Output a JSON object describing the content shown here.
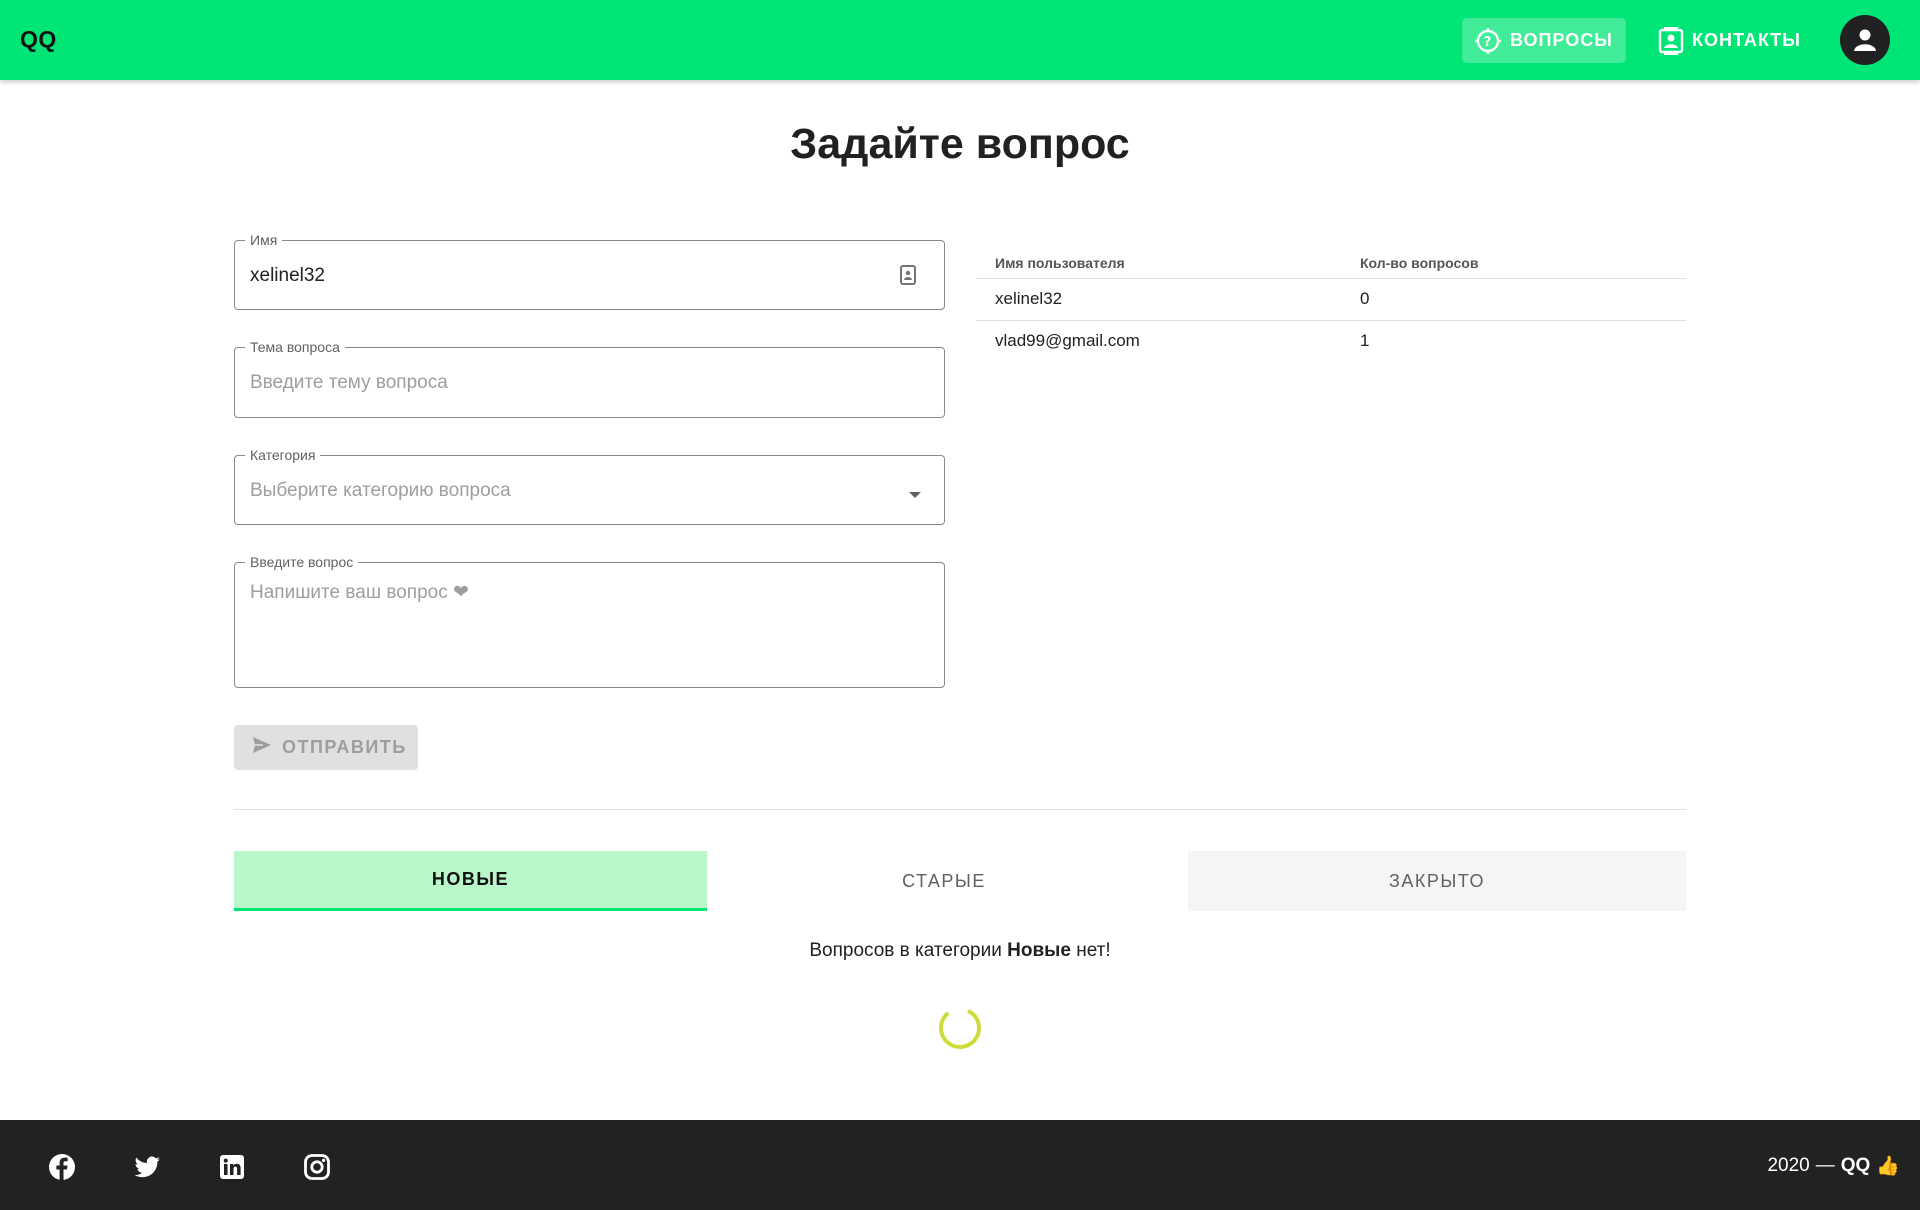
{
  "header": {
    "brand": "QQ",
    "nav": [
      {
        "label": "ВОПРОСЫ",
        "icon": "question-target-icon",
        "active": true
      },
      {
        "label": "КОНТАКТЫ",
        "icon": "contacts-card-icon",
        "active": false
      }
    ],
    "avatar_icon": "account-icon"
  },
  "page": {
    "title": "Задайте вопрос"
  },
  "form": {
    "name": {
      "label": "Имя",
      "value": "xelinel32",
      "icon": "id-card-icon"
    },
    "topic": {
      "label": "Тема вопроса",
      "placeholder": "Введите тему вопроса"
    },
    "category": {
      "label": "Категория",
      "placeholder": "Выберите категорию вопроса",
      "icon": "dropdown-arrow-icon"
    },
    "question": {
      "label": "Введите вопрос",
      "placeholder": "Напишите ваш вопрос ❤"
    },
    "submit": {
      "label": "ОТПРАВИТЬ",
      "icon": "send-icon",
      "disabled": true
    }
  },
  "users_table": {
    "headers": [
      "Имя пользователя",
      "Кол-во вопросов"
    ],
    "rows": [
      [
        "xelinel32",
        "0"
      ],
      [
        "vlad99@gmail.com",
        "1"
      ]
    ]
  },
  "tabs": [
    {
      "label": "НОВЫЕ",
      "active": true
    },
    {
      "label": "СТАРЫЕ",
      "active": false
    },
    {
      "label": "ЗАКРЫТО",
      "active": false
    }
  ],
  "empty_state": {
    "prefix": "Вопросов в категории",
    "category": "Новые",
    "suffix": "нет!"
  },
  "footer": {
    "social": [
      "facebook-icon",
      "twitter-icon",
      "linkedin-icon",
      "instagram-icon"
    ],
    "year": "2020",
    "dash": "—",
    "brand": "QQ",
    "emoji": "👍"
  },
  "colors": {
    "primary": "#00e676",
    "tab_active_bg": "#b9f6ca",
    "footer_bg": "#222222",
    "spinner": "#cddc39"
  }
}
